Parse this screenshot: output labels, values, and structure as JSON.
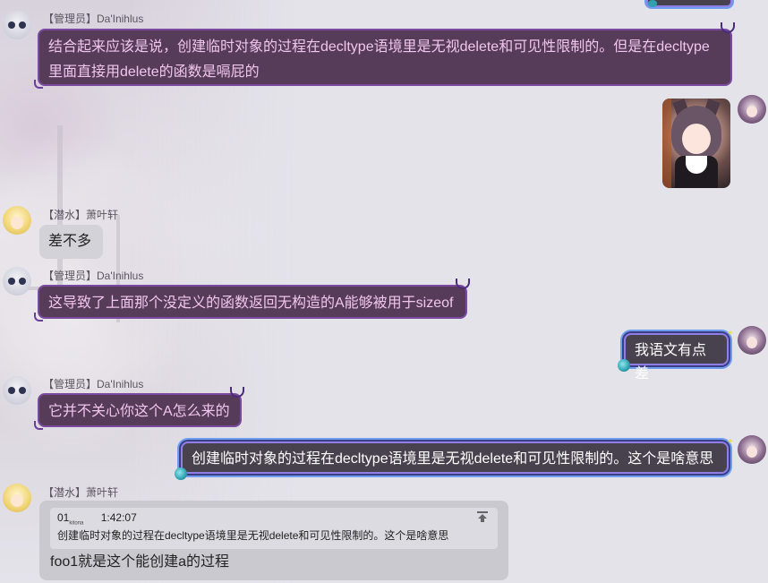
{
  "messages": [
    {
      "sender": "【管理员】Da'Inihlus",
      "text_lines": [
        "结合起来应该是说，创建临时对象的过程在decltype语境里是无视delete和可见性限制的。但是在decltype",
        "里面直接用delete的函数是嗝屁的"
      ]
    },
    {
      "sender": "【潜水】萧叶轩",
      "text": "差不多"
    },
    {
      "sender": "【管理员】Da'Inihlus",
      "text": "这导致了上面那个没定义的函数返回无构造的A能够被用于sizeof"
    },
    {
      "text": "我语文有点差"
    },
    {
      "sender": "【管理员】Da'Inihlus",
      "text": "它并不关心你这个A怎么来的"
    },
    {
      "text": "创建临时对象的过程在decltype语境里是无视delete和可见性限制的。这个是啥意思"
    },
    {
      "sender": "【潜水】萧叶轩",
      "quote": {
        "author": "01",
        "author_sub": "kitona",
        "time": "1:42:07",
        "text": "创建临时对象的过程在decltype语境里是无视delete和可见性限制的。这个是啥意思"
      },
      "text": "foo1就是这个能创建a的过程"
    }
  ],
  "colors": {
    "background": "#e4e3ea",
    "admin_bubble": "#573c5a",
    "admin_text": "#f0c5ee",
    "my_bubble": "#48424e",
    "my_border": "#6f9df0",
    "gray_bubble": "#d3d2d9"
  },
  "icons": [
    "admin-avatar-icon",
    "blond-avatar-icon",
    "my-avatar-icon",
    "jump-to-original-icon"
  ]
}
